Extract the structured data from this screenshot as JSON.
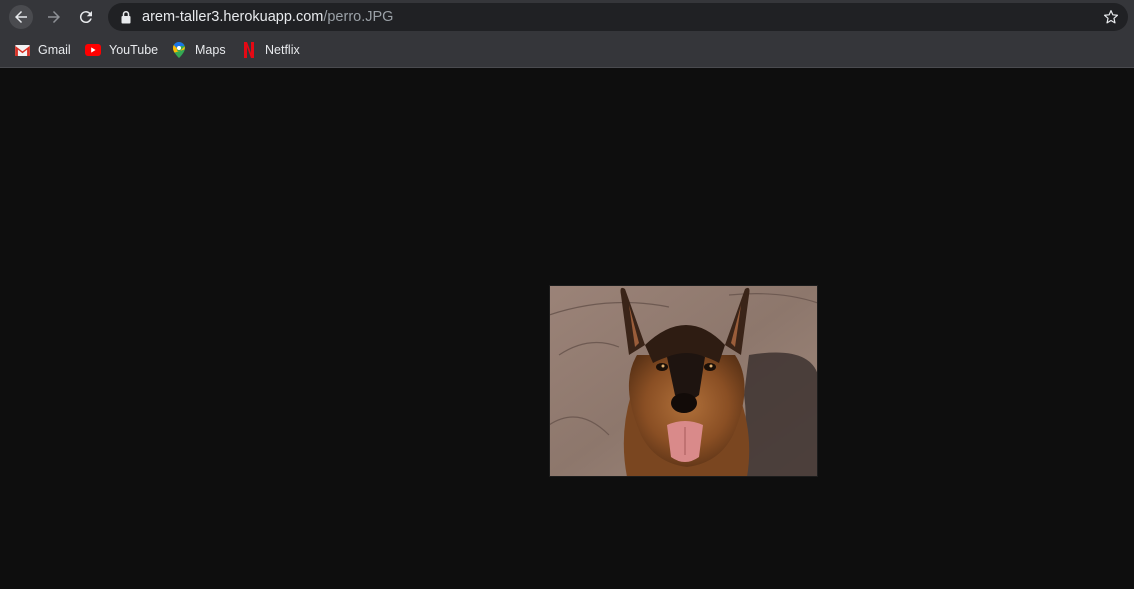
{
  "browser": {
    "url_host": "arem-taller3.herokuapp.com",
    "url_path": "/perro.JPG",
    "nav_icons": [
      "back-arrow-icon",
      "forward-arrow-icon",
      "reload-icon",
      "lock-icon",
      "star-icon"
    ]
  },
  "bookmarks": [
    {
      "label": "Gmail",
      "icon": "gmail-icon"
    },
    {
      "label": "YouTube",
      "icon": "youtube-icon"
    },
    {
      "label": "Maps",
      "icon": "maps-icon"
    },
    {
      "label": "Netflix",
      "icon": "netflix-icon"
    }
  ],
  "page": {
    "background": "#0e0e0e",
    "image_subject": "german-shepherd-dog-photo"
  }
}
